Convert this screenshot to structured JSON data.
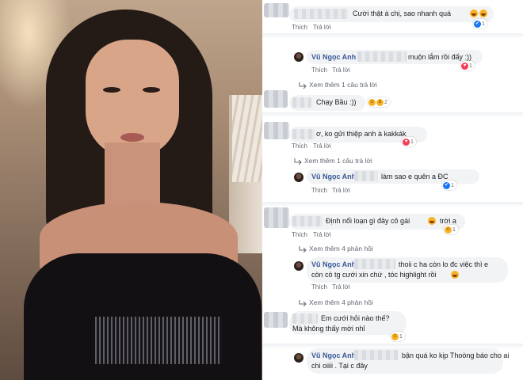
{
  "colors": {
    "name": "#385898",
    "text": "#1c1e21",
    "meta": "#606770",
    "bubble": "#f2f3f5",
    "like": "#1877f2",
    "love": "#f33e58"
  },
  "photo": {
    "icon": "portrait-photo"
  },
  "actions": {
    "like": "Thích",
    "reply": "Trả lời"
  },
  "comments": [
    {
      "text": "Cười thật à chị, sao nhanh quá",
      "react_count": "1"
    },
    {
      "author": "Vũ Ngọc Anh",
      "text": "muộn lắm rồi đấy :))",
      "react_count": "1"
    },
    {
      "more": "Xem thêm 1 câu trả lời"
    },
    {
      "text": "Chạy Bầu :))",
      "react_count": "2"
    },
    {
      "text": "ơ, ko gửi thiệp anh à kakkák",
      "react_count": "1"
    },
    {
      "more": "Xem thêm 1 câu trả lời"
    },
    {
      "author": "Vũ Ngọc Anh",
      "text": "làm sao e quên a ĐC",
      "react_count": "1"
    },
    {
      "text": "Định nổi loạn gì đây cô gái",
      "text_tail": "trời a",
      "react_count": "1"
    },
    {
      "more": "Xem thêm 4 phản hồi"
    },
    {
      "author": "Vũ Ngọc Anh",
      "text": "thoii c ha còn lo đc việc thì e",
      "text2": "còn có tg cưới xin chứ , tóc highlight rồi"
    },
    {
      "more": "Xem thêm 4 phản hồi"
    },
    {
      "text": "Em cưới hỏi nào thế?",
      "text2": "Mà không thấy mời nhỉ",
      "react_count": "1"
    },
    {
      "author": "Vũ Ngọc Anh",
      "text": "bận quá ko kịp Thoòng báo cho ai",
      "text2": "chi oiiii . Tại c đây"
    }
  ]
}
